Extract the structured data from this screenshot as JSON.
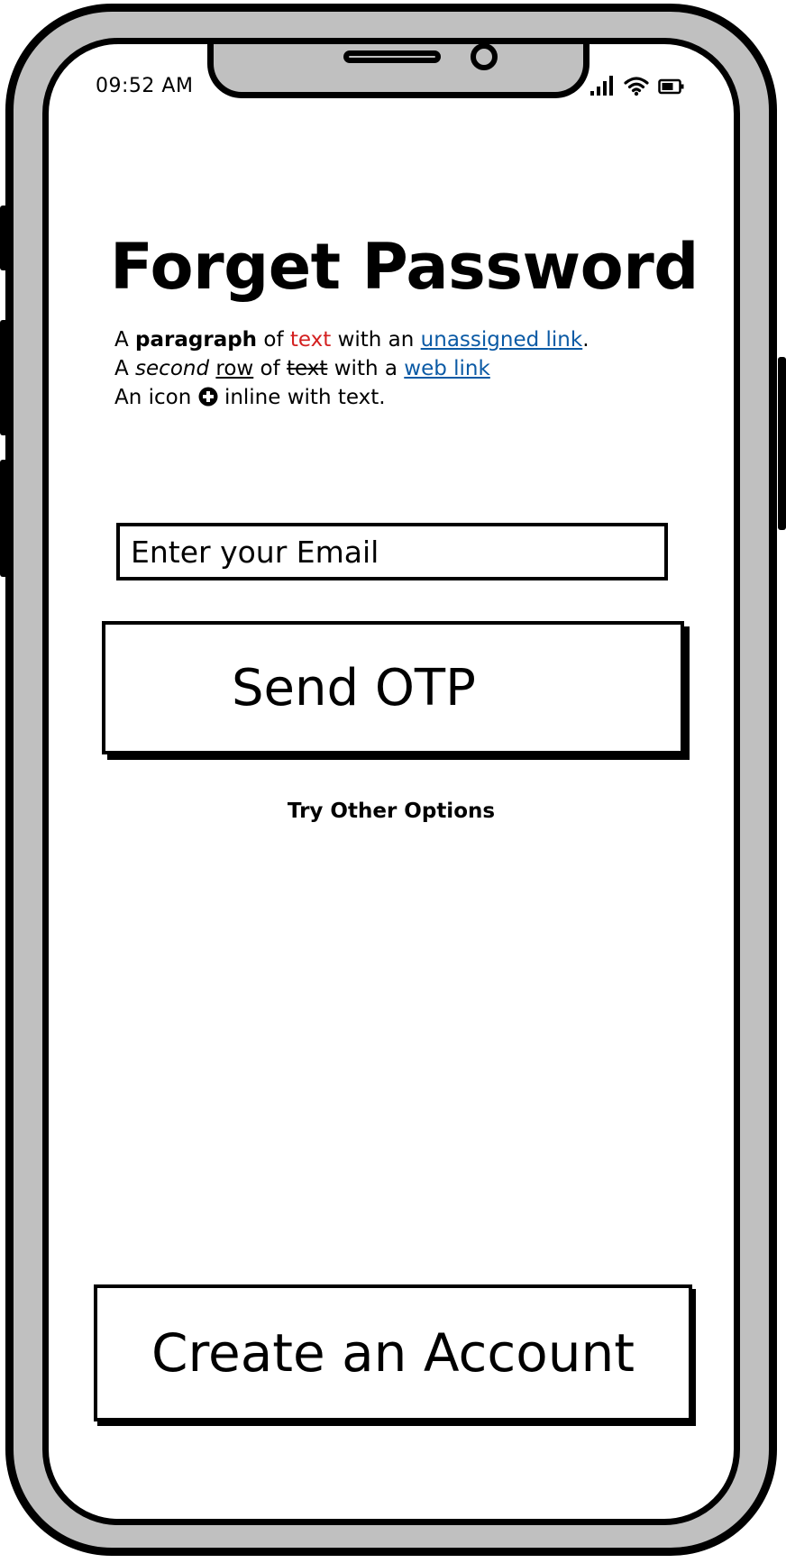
{
  "status_bar": {
    "time": "09:52 AM",
    "icons": [
      "cellular-signal-icon",
      "wifi-icon",
      "battery-icon"
    ]
  },
  "header": {
    "title": "Forget Password"
  },
  "paragraph": {
    "line1": {
      "word_a": "A",
      "bold": "paragraph",
      "of": "of",
      "red": "text",
      "with_an": "with an",
      "link": "unassigned link",
      "period": "."
    },
    "line2": {
      "word_a": "A",
      "italic": "second",
      "underlined": "row",
      "of": "of",
      "struck": "text",
      "with_a": "with a",
      "link": "web link"
    },
    "line3": {
      "before_icon": "An icon",
      "icon": "plus-circle-icon",
      "after_icon": "inline with text."
    }
  },
  "form": {
    "email_placeholder": "Enter your Email",
    "send_button_label": "Send OTP",
    "other_options_label": "Try Other Options"
  },
  "footer": {
    "create_account_label": "Create an Account"
  },
  "colors": {
    "frame": "#c0c0c0",
    "red_text": "#d42020",
    "link": "#0b5aa5"
  }
}
